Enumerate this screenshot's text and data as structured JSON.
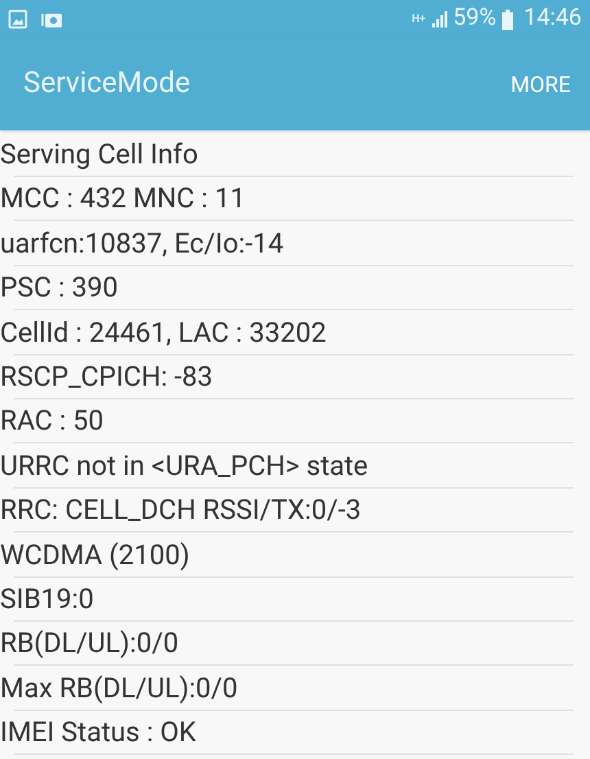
{
  "status_bar": {
    "network": "H+",
    "battery": "59%",
    "time": "14:46"
  },
  "app_bar": {
    "title": "ServiceMode",
    "action": "MORE"
  },
  "rows": [
    "Serving Cell Info",
    "MCC : 432 MNC : 11",
    "uarfcn:10837, Ec/Io:-14",
    "PSC : 390",
    "CellId : 24461, LAC : 33202",
    "RSCP_CPICH: -83",
    "RAC : 50",
    "URRC not in <URA_PCH> state",
    "RRC: CELL_DCH RSSI/TX:0/-3",
    "WCDMA (2100)",
    "SIB19:0",
    "RB(DL/UL):0/0",
    "Max RB(DL/UL):0/0",
    "IMEI Status : OK"
  ]
}
